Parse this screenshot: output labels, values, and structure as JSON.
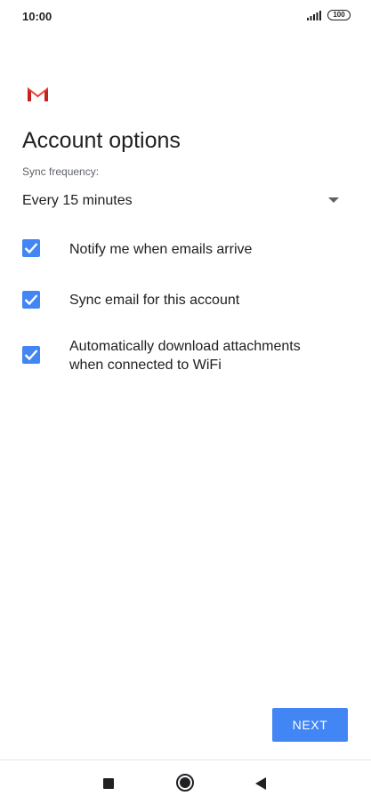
{
  "status_bar": {
    "time": "10:00",
    "battery": "100"
  },
  "logo": {
    "icon": "gmail-m-icon"
  },
  "page": {
    "title": "Account options",
    "sync_label": "Sync frequency:",
    "sync_value": "Every 15 minutes"
  },
  "options": [
    {
      "label": "Notify me when emails arrive",
      "checked": true
    },
    {
      "label": "Sync email for this account",
      "checked": true
    },
    {
      "label": "Automatically download attachments when connected to WiFi",
      "checked": true
    }
  ],
  "actions": {
    "next_label": "NEXT"
  },
  "colors": {
    "accent": "#4285f4",
    "gmail_red": "#d93025",
    "text": "#202124"
  },
  "nav_bar": {
    "icons": [
      "recent-apps-icon",
      "home-icon",
      "back-icon"
    ]
  }
}
